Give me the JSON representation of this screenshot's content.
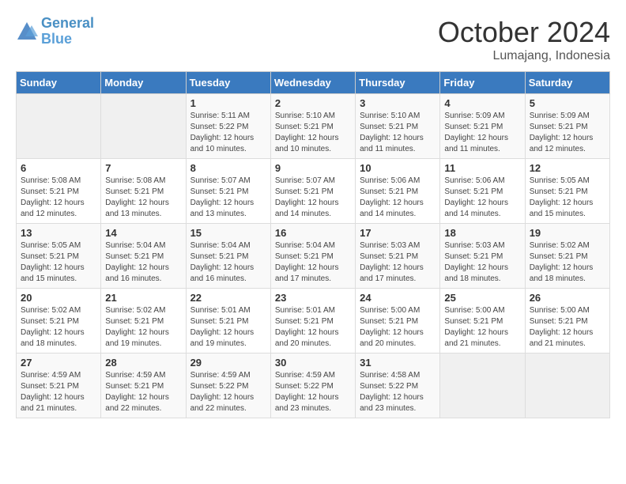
{
  "logo": {
    "line1": "General",
    "line2": "Blue"
  },
  "title": "October 2024",
  "location": "Lumajang, Indonesia",
  "days_of_week": [
    "Sunday",
    "Monday",
    "Tuesday",
    "Wednesday",
    "Thursday",
    "Friday",
    "Saturday"
  ],
  "weeks": [
    [
      {
        "day": "",
        "content": ""
      },
      {
        "day": "",
        "content": ""
      },
      {
        "day": "1",
        "content": "Sunrise: 5:11 AM\nSunset: 5:22 PM\nDaylight: 12 hours\nand 10 minutes."
      },
      {
        "day": "2",
        "content": "Sunrise: 5:10 AM\nSunset: 5:21 PM\nDaylight: 12 hours\nand 10 minutes."
      },
      {
        "day": "3",
        "content": "Sunrise: 5:10 AM\nSunset: 5:21 PM\nDaylight: 12 hours\nand 11 minutes."
      },
      {
        "day": "4",
        "content": "Sunrise: 5:09 AM\nSunset: 5:21 PM\nDaylight: 12 hours\nand 11 minutes."
      },
      {
        "day": "5",
        "content": "Sunrise: 5:09 AM\nSunset: 5:21 PM\nDaylight: 12 hours\nand 12 minutes."
      }
    ],
    [
      {
        "day": "6",
        "content": "Sunrise: 5:08 AM\nSunset: 5:21 PM\nDaylight: 12 hours\nand 12 minutes."
      },
      {
        "day": "7",
        "content": "Sunrise: 5:08 AM\nSunset: 5:21 PM\nDaylight: 12 hours\nand 13 minutes."
      },
      {
        "day": "8",
        "content": "Sunrise: 5:07 AM\nSunset: 5:21 PM\nDaylight: 12 hours\nand 13 minutes."
      },
      {
        "day": "9",
        "content": "Sunrise: 5:07 AM\nSunset: 5:21 PM\nDaylight: 12 hours\nand 14 minutes."
      },
      {
        "day": "10",
        "content": "Sunrise: 5:06 AM\nSunset: 5:21 PM\nDaylight: 12 hours\nand 14 minutes."
      },
      {
        "day": "11",
        "content": "Sunrise: 5:06 AM\nSunset: 5:21 PM\nDaylight: 12 hours\nand 14 minutes."
      },
      {
        "day": "12",
        "content": "Sunrise: 5:05 AM\nSunset: 5:21 PM\nDaylight: 12 hours\nand 15 minutes."
      }
    ],
    [
      {
        "day": "13",
        "content": "Sunrise: 5:05 AM\nSunset: 5:21 PM\nDaylight: 12 hours\nand 15 minutes."
      },
      {
        "day": "14",
        "content": "Sunrise: 5:04 AM\nSunset: 5:21 PM\nDaylight: 12 hours\nand 16 minutes."
      },
      {
        "day": "15",
        "content": "Sunrise: 5:04 AM\nSunset: 5:21 PM\nDaylight: 12 hours\nand 16 minutes."
      },
      {
        "day": "16",
        "content": "Sunrise: 5:04 AM\nSunset: 5:21 PM\nDaylight: 12 hours\nand 17 minutes."
      },
      {
        "day": "17",
        "content": "Sunrise: 5:03 AM\nSunset: 5:21 PM\nDaylight: 12 hours\nand 17 minutes."
      },
      {
        "day": "18",
        "content": "Sunrise: 5:03 AM\nSunset: 5:21 PM\nDaylight: 12 hours\nand 18 minutes."
      },
      {
        "day": "19",
        "content": "Sunrise: 5:02 AM\nSunset: 5:21 PM\nDaylight: 12 hours\nand 18 minutes."
      }
    ],
    [
      {
        "day": "20",
        "content": "Sunrise: 5:02 AM\nSunset: 5:21 PM\nDaylight: 12 hours\nand 18 minutes."
      },
      {
        "day": "21",
        "content": "Sunrise: 5:02 AM\nSunset: 5:21 PM\nDaylight: 12 hours\nand 19 minutes."
      },
      {
        "day": "22",
        "content": "Sunrise: 5:01 AM\nSunset: 5:21 PM\nDaylight: 12 hours\nand 19 minutes."
      },
      {
        "day": "23",
        "content": "Sunrise: 5:01 AM\nSunset: 5:21 PM\nDaylight: 12 hours\nand 20 minutes."
      },
      {
        "day": "24",
        "content": "Sunrise: 5:00 AM\nSunset: 5:21 PM\nDaylight: 12 hours\nand 20 minutes."
      },
      {
        "day": "25",
        "content": "Sunrise: 5:00 AM\nSunset: 5:21 PM\nDaylight: 12 hours\nand 21 minutes."
      },
      {
        "day": "26",
        "content": "Sunrise: 5:00 AM\nSunset: 5:21 PM\nDaylight: 12 hours\nand 21 minutes."
      }
    ],
    [
      {
        "day": "27",
        "content": "Sunrise: 4:59 AM\nSunset: 5:21 PM\nDaylight: 12 hours\nand 21 minutes."
      },
      {
        "day": "28",
        "content": "Sunrise: 4:59 AM\nSunset: 5:21 PM\nDaylight: 12 hours\nand 22 minutes."
      },
      {
        "day": "29",
        "content": "Sunrise: 4:59 AM\nSunset: 5:22 PM\nDaylight: 12 hours\nand 22 minutes."
      },
      {
        "day": "30",
        "content": "Sunrise: 4:59 AM\nSunset: 5:22 PM\nDaylight: 12 hours\nand 23 minutes."
      },
      {
        "day": "31",
        "content": "Sunrise: 4:58 AM\nSunset: 5:22 PM\nDaylight: 12 hours\nand 23 minutes."
      },
      {
        "day": "",
        "content": ""
      },
      {
        "day": "",
        "content": ""
      }
    ]
  ]
}
